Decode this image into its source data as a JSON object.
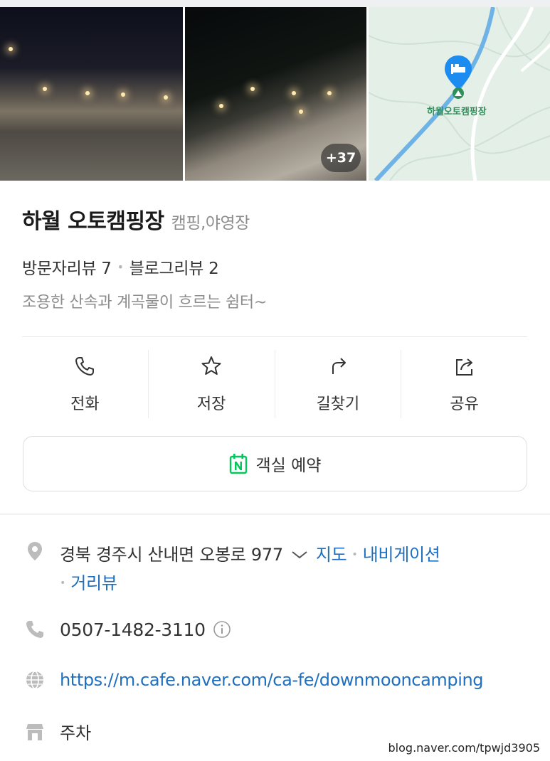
{
  "gallery": {
    "more_count": "+37"
  },
  "map": {
    "pin_label": "하월오토캠핑장"
  },
  "place": {
    "name": "하월 오토캠핑장",
    "category": "캠핑,야영장",
    "visitor_reviews": "방문자리뷰 7",
    "blog_reviews": "블로그리뷰 2",
    "description": "조용한 산속과 계곡물이 흐르는 쉼터~"
  },
  "actions": [
    {
      "label": "전화",
      "icon": "phone-icon"
    },
    {
      "label": "저장",
      "icon": "star-icon"
    },
    {
      "label": "길찾기",
      "icon": "directions-icon"
    },
    {
      "label": "공유",
      "icon": "share-icon"
    }
  ],
  "reservation": {
    "label": "객실 예약",
    "icon": "naver-booking-icon"
  },
  "info": {
    "address": "경북 경주시 산내면 오봉로 977",
    "map_link": "지도",
    "navigation_link": "내비게이션",
    "street_view_link": "거리뷰",
    "phone": "0507-1482-3110",
    "website": "https://m.cafe.naver.com/ca-fe/downmooncamping",
    "parking": "주차"
  },
  "watermark": "blog.naver.com/tpwjd3905",
  "colors": {
    "link": "#1f6fbf",
    "naver_green": "#03c75a",
    "pin_blue": "#1c8cf0",
    "muted_text": "#8c8c8c"
  }
}
